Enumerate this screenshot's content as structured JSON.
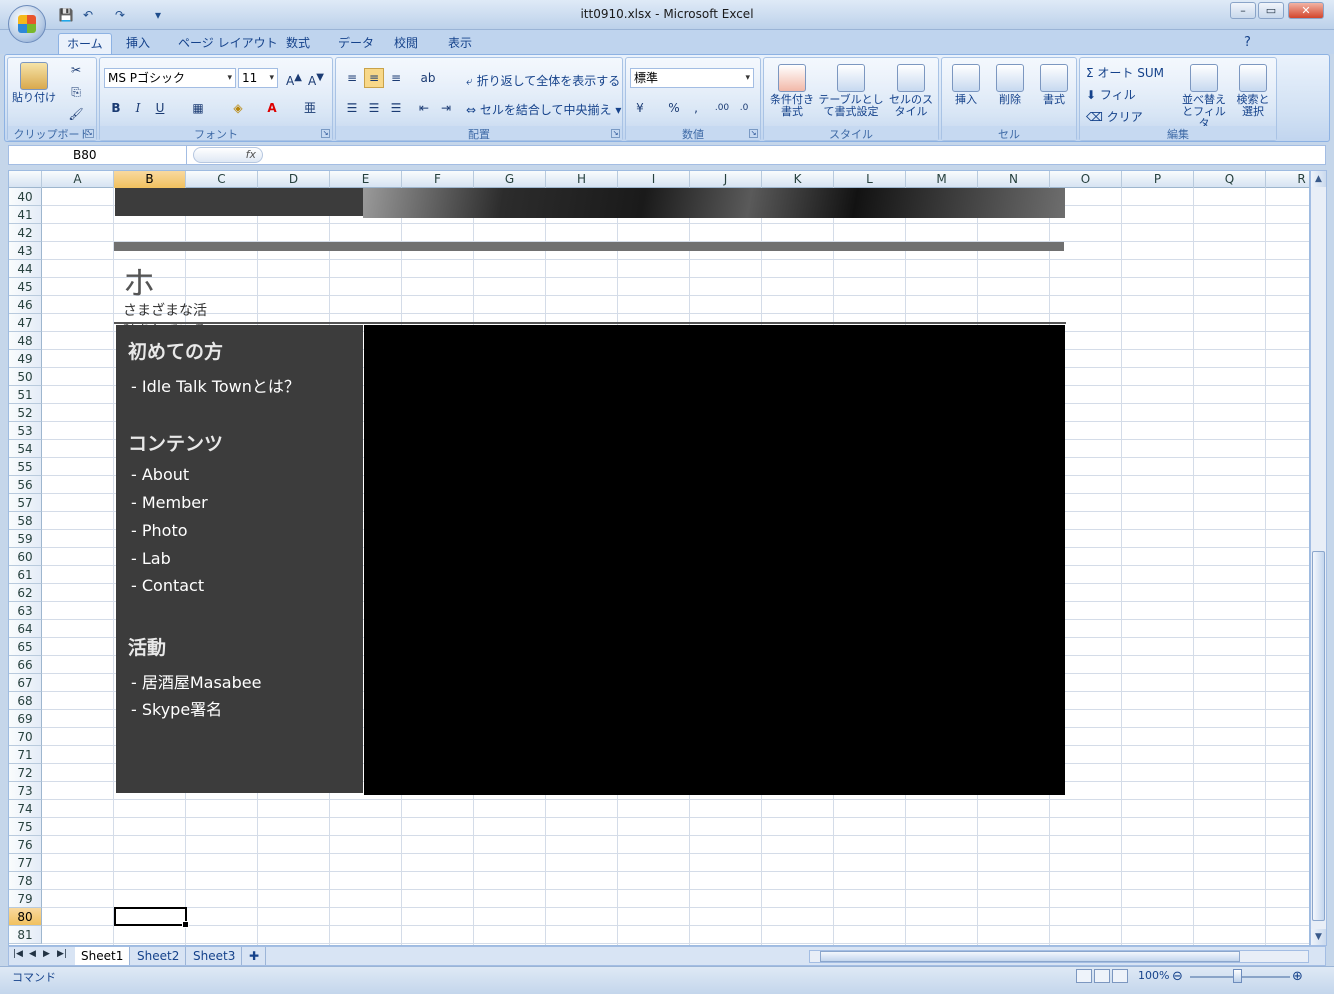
{
  "app": {
    "title": "itt0910.xlsx - Microsoft Excel",
    "window_buttons": {
      "minimize": "–",
      "restore": "▭",
      "close": "✕"
    }
  },
  "quick_access": {
    "save_icon": "save-icon",
    "undo_icon": "undo-icon",
    "redo_icon": "redo-icon"
  },
  "tabs": [
    "ホーム",
    "挿入",
    "ページ レイアウト",
    "数式",
    "データ",
    "校閲",
    "表示"
  ],
  "ribbon": {
    "clipboard": {
      "label": "クリップボード",
      "paste": "貼り付け"
    },
    "font": {
      "label": "フォント",
      "name": "MS Pゴシック",
      "size": "11",
      "bold": "B",
      "italic": "I",
      "underline": "U"
    },
    "alignment": {
      "label": "配置",
      "wrap": "折り返して全体を表示する",
      "merge": "セルを結合して中央揃え"
    },
    "number": {
      "label": "数値",
      "format": "標準",
      "percent": "%",
      "comma": ","
    },
    "styles": {
      "label": "スタイル",
      "cond_format": "条件付き書式",
      "table_format": "テーブルとして書式設定",
      "cell_styles": "セルのスタイル"
    },
    "cells": {
      "label": "セル",
      "insert": "挿入",
      "delete": "削除",
      "format": "書式"
    },
    "editing": {
      "label": "編集",
      "autosum": "Σ オート SUM",
      "fill": "フィル",
      "clear": "クリア",
      "sort": "並べ替えとフィルタ",
      "find": "検索と選択"
    }
  },
  "formula_bar": {
    "name_box": "B80",
    "fx": "fx",
    "content": ""
  },
  "columns": [
    "A",
    "B",
    "C",
    "D",
    "E",
    "F",
    "G",
    "H",
    "I",
    "J",
    "K",
    "L",
    "M",
    "N",
    "O",
    "P",
    "Q",
    "R"
  ],
  "selected_column": "B",
  "rows": [
    "40",
    "41",
    "42",
    "43",
    "44",
    "45",
    "46",
    "47",
    "48",
    "49",
    "50",
    "51",
    "52",
    "53",
    "54",
    "55",
    "56",
    "57",
    "58",
    "59",
    "60",
    "61",
    "62",
    "63",
    "64",
    "65",
    "66",
    "67",
    "68",
    "69",
    "70",
    "71",
    "72",
    "73",
    "74",
    "75",
    "76",
    "77",
    "78",
    "79",
    "80",
    "81"
  ],
  "selected_row": "80",
  "content": {
    "heading": "ホーム",
    "subheading": "さまざまな活動をしているIdleTalkTownのトップページ",
    "sections": [
      {
        "title": "初めての方",
        "items": [
          "- Idle Talk Townとは？"
        ]
      },
      {
        "title": "コンテンツ",
        "items": [
          "- About",
          "- Member",
          "- Photo",
          "- Lab",
          "- Contact"
        ]
      },
      {
        "title": "活動",
        "items": [
          "- 居酒屋Masabee",
          "- Skype署名"
        ]
      }
    ]
  },
  "sheets": [
    "Sheet1",
    "Sheet2",
    "Sheet3"
  ],
  "active_sheet": "Sheet1",
  "status": {
    "mode": "コマンド",
    "zoom": "100%"
  }
}
